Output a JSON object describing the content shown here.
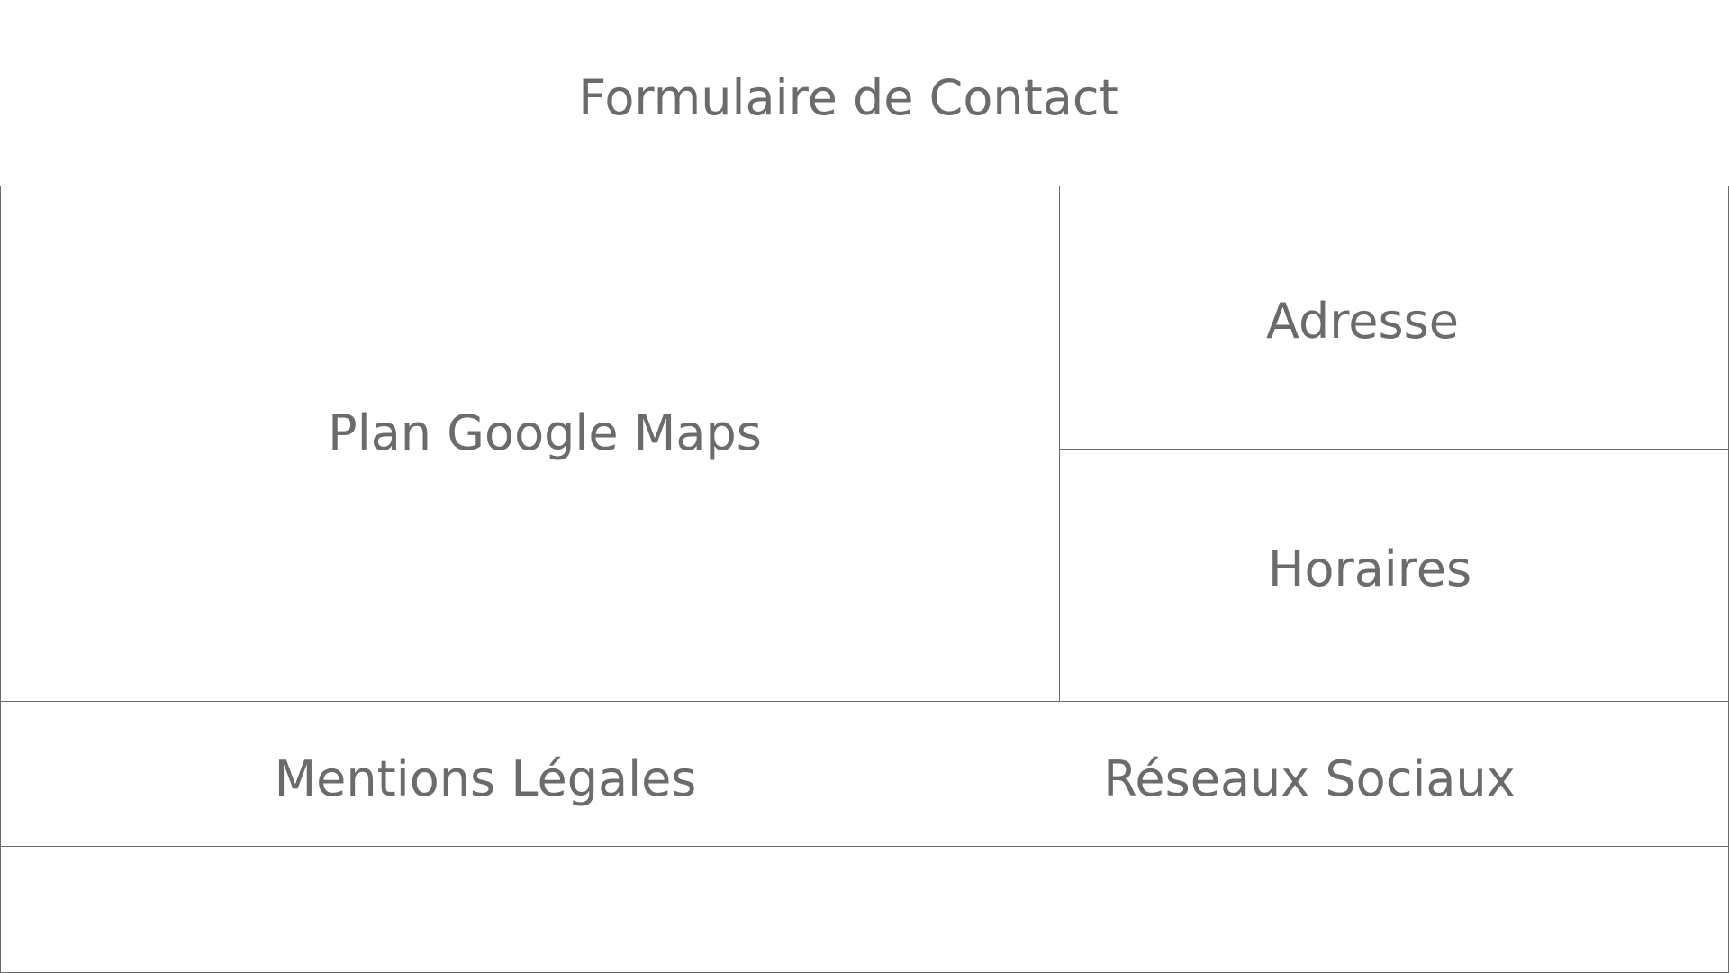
{
  "header": {
    "title": "Formulaire de Contact"
  },
  "main": {
    "map_label": "Plan Google Maps",
    "address_label": "Adresse",
    "hours_label": "Horaires"
  },
  "footer": {
    "legal_label": "Mentions Légales",
    "social_label": "Réseaux Sociaux"
  },
  "colors": {
    "lines": "#6b6b6b",
    "text": "#6b6b6b",
    "background": "#ffffff"
  }
}
